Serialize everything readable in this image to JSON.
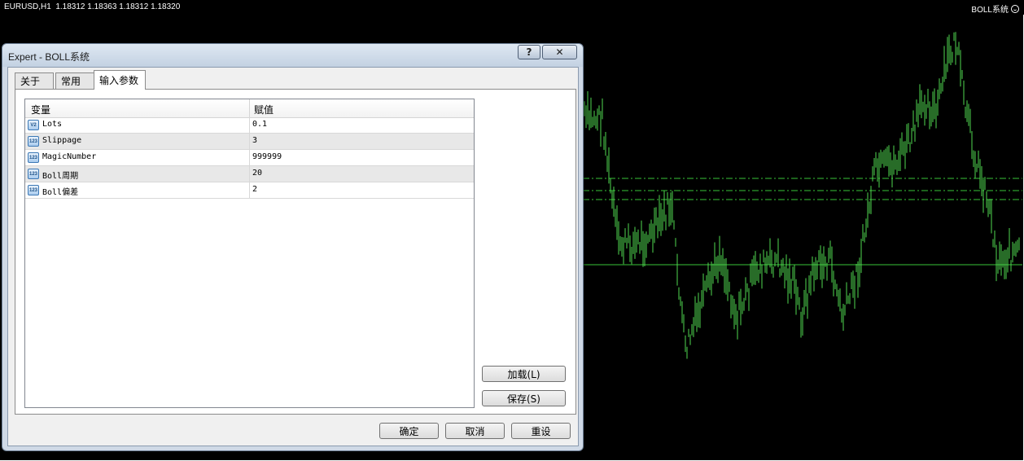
{
  "chart": {
    "symbol_line": "EURUSD,H1  1.18312 1.18363 1.18312 1.18320",
    "expert_label": "BOLL系统"
  },
  "dialog": {
    "title": "Expert - BOLL系统",
    "help_label": "?",
    "close_label": "✕",
    "tabs": [
      {
        "label": "关于"
      },
      {
        "label": "常用"
      },
      {
        "label": "输入参数"
      }
    ],
    "table": {
      "columns": [
        "变量",
        "赋值"
      ],
      "rows": [
        {
          "icon": "V2",
          "name": "Lots",
          "value": "0.1"
        },
        {
          "icon": "123",
          "name": "Slippage",
          "value": "3"
        },
        {
          "icon": "123",
          "name": "MagicNumber",
          "value": "999999"
        },
        {
          "icon": "123",
          "name": "Boll周期",
          "value": "20"
        },
        {
          "icon": "123",
          "name": "Boll偏差",
          "value": "2"
        }
      ]
    },
    "load_label": "加载(L)",
    "save_label": "保存(S)",
    "ok_label": "确定",
    "cancel_label": "取消",
    "reset_label": "重设"
  },
  "colors": {
    "chart_background": "#000000",
    "bar_color": "#4fd84f",
    "level_color": "#39c439"
  }
}
